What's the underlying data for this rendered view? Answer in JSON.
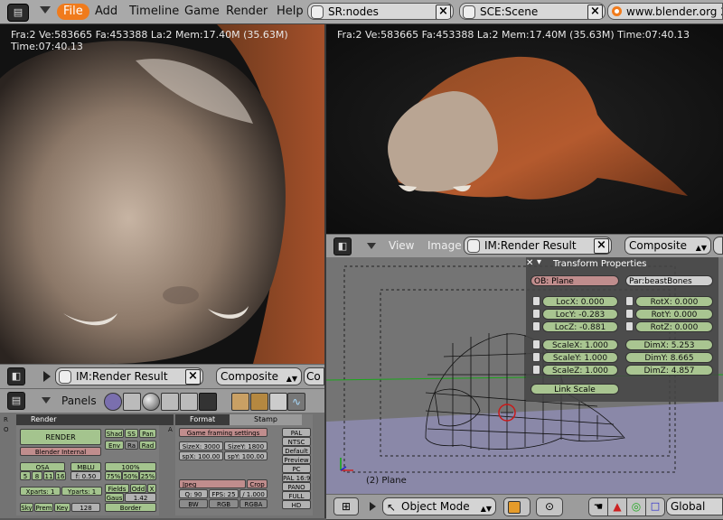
{
  "topbar": {
    "menus": [
      "File",
      "Add",
      "Timeline",
      "Game",
      "Render",
      "Help"
    ],
    "screen_selector": "SR:nodes",
    "scene_selector": "SCE:Scene",
    "url": "www.blender.org 2"
  },
  "render_left": {
    "stats": "Fra:2  Ve:583665 Fa:453388 La:2 Mem:17.40M (35.63M) Time:07:40.13",
    "image_selector": "IM:Render Result",
    "composite_selector": "Composite",
    "composite_trunc": "Co"
  },
  "render_right": {
    "stats": "Fra:2  Ve:583665 Fa:453388 La:2 Mem:17.40M (35.63M) Time:07:40.13",
    "menu_view": "View",
    "menu_image": "Image",
    "image_selector": "IM:Render Result",
    "composite_selector": "Composite"
  },
  "buttons_window": {
    "panels_label": "Panels",
    "render_panel": {
      "title": "Render",
      "render_button": "RENDER",
      "shad": "Shad",
      "ss": "SS",
      "pan": "Pan",
      "env": "Env",
      "ra": "Ra",
      "rad": "Rad",
      "renderer": "Blender Internal",
      "osa": "OSA",
      "mblur": "MBLU",
      "osa_values": [
        "5",
        "8",
        "11",
        "16"
      ],
      "mblur_value": "f: 0.50",
      "pct_100": "100%",
      "pcts": [
        "75%",
        "50%",
        "25%"
      ],
      "xparts": "Xparts: 1",
      "yparts": "Yparts: 1",
      "fields": "Fields",
      "odd": "Odd",
      "x_toggle": "X",
      "gauss": "Gaus",
      "gauss_value": "1.42",
      "sky": "Sky",
      "prem": "Prem",
      "key": "Key",
      "bits": "128",
      "border": "Border"
    },
    "format_panel": {
      "tab_format": "Format",
      "tab_stamp": "Stamp",
      "preset": "Game framing settings",
      "sizex": "SizeX: 3000",
      "sizey": "SizeY: 1800",
      "aspx": "spX: 100.00",
      "aspy": "spY: 100.00",
      "presets": [
        "PAL",
        "NTSC",
        "Default",
        "Preview",
        "PC",
        "PAL 16:9",
        "PANO",
        "FULL",
        "HD"
      ],
      "file_format": "Jpeg",
      "crop": "Crop",
      "quality": "Q: 90",
      "fps": "FPS: 25",
      "fps_base": "/ 1.000",
      "bw": "BW",
      "rgb": "RGB",
      "rgba": "RGBA"
    }
  },
  "viewport3d": {
    "object_label": "(2) Plane",
    "mode": "Object Mode",
    "orientation": "Global"
  },
  "transform_panel": {
    "title": "Transform Properties",
    "ob": "OB: Plane",
    "par": "Par:beastBones",
    "loc": [
      "LocX: 0.000",
      "LocY: -0.283",
      "LocZ: -0.881"
    ],
    "rot": [
      "RotX: 0.000",
      "RotY: 0.000",
      "RotZ: 0.000"
    ],
    "scale": [
      "ScaleX: 1.000",
      "ScaleY: 1.000",
      "ScaleZ: 1.000"
    ],
    "dim": [
      "DimX: 5.253",
      "DimY: 8.665",
      "DimZ: 4.857"
    ],
    "link_scale": "Link Scale"
  },
  "colors": {
    "accent_file": "#f07b1c",
    "field_green": "#a9c591",
    "field_pink": "#c08d8d",
    "header_gray": "#a9a9a9"
  }
}
